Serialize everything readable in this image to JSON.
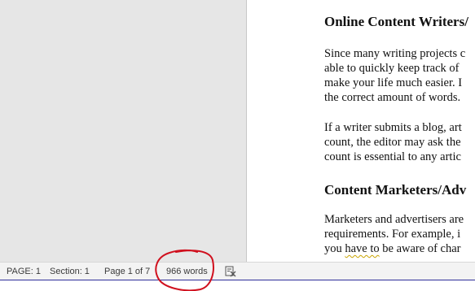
{
  "document": {
    "heading1": "Online Content Writers/",
    "para1": [
      "Since many writing projects c",
      "able to quickly keep track of",
      "make your life much easier. I",
      "the correct amount of words."
    ],
    "para2": [
      "If a writer submits a blog, art",
      "count, the editor may ask the",
      "count is essential to any artic"
    ],
    "heading2": "Content Marketers/Adv",
    "para3": {
      "line1": "Marketers and advertisers are",
      "line2": "requirements. For example, i",
      "line3_before": "you ",
      "line3_squiggle": "have to",
      "line3_after": " be aware of char"
    }
  },
  "statusbar": {
    "page": "PAGE: 1",
    "section": "Section: 1",
    "page_of": "Page 1 of 7",
    "word_count": "966 words"
  },
  "icons": {
    "track_changes": "track-changes-icon"
  },
  "colors": {
    "annotation_circle": "#d0101e",
    "statusbar_bg": "#f3f3f3",
    "canvas_bg": "#e6e6e6"
  }
}
